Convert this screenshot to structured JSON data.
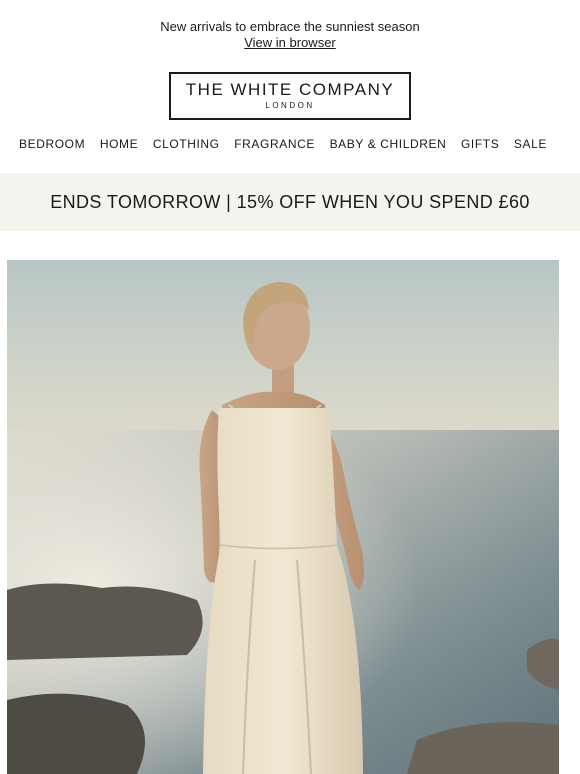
{
  "preheader": {
    "tagline": "New arrivals to embrace the sunniest season",
    "view_in_browser": "View in browser"
  },
  "logo": {
    "name": "THE WHITE COMPANY",
    "sub": "LONDON"
  },
  "nav": {
    "items": [
      "BEDROOM",
      "HOME",
      "CLOTHING",
      "FRAGRANCE",
      "BABY & CHILDREN",
      "GIFTS",
      "SALE"
    ]
  },
  "promo": {
    "text": "ENDS TOMORROW | 15% OFF WHEN YOU SPEND £60"
  },
  "colors": {
    "promo_bg": "#f4f4ef",
    "text": "#1a1a1a"
  }
}
